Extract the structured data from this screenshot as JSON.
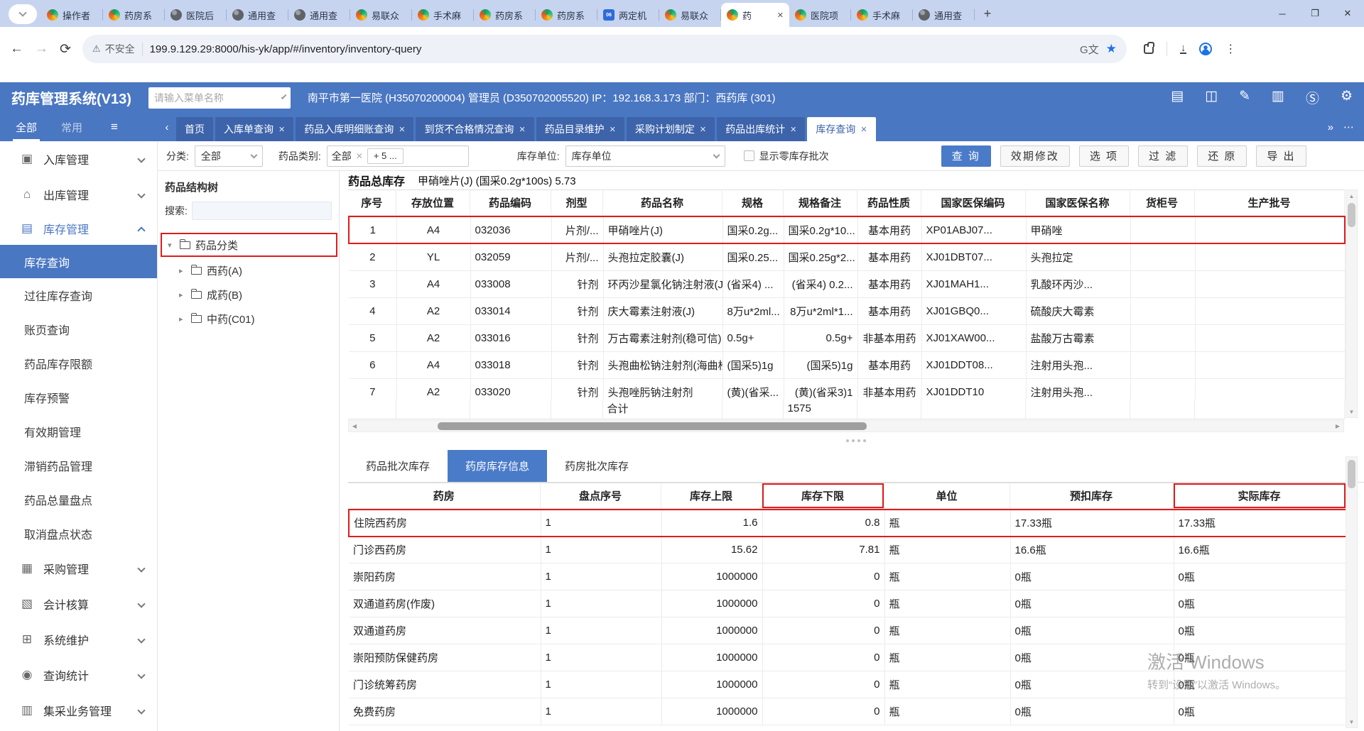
{
  "accent_color": "#4a77c2",
  "annotation_red": "#e11b1b",
  "browser": {
    "tabs": [
      {
        "label": "操作者",
        "icon": "swirl"
      },
      {
        "label": "药房系",
        "icon": "swirl"
      },
      {
        "label": "医院后",
        "icon": "globe"
      },
      {
        "label": "通用查",
        "icon": "globe"
      },
      {
        "label": "通用查",
        "icon": "globe"
      },
      {
        "label": "易联众",
        "icon": "swirl"
      },
      {
        "label": "手术麻",
        "icon": "swirl"
      },
      {
        "label": "药房系",
        "icon": "swirl"
      },
      {
        "label": "药房系",
        "icon": "swirl"
      },
      {
        "label": "两定机",
        "icon": "bluesq",
        "badge": "06"
      },
      {
        "label": "易联众",
        "icon": "swirl"
      },
      {
        "label": "药",
        "icon": "swirl",
        "active": true
      },
      {
        "label": "医院项",
        "icon": "swirl"
      },
      {
        "label": "手术麻",
        "icon": "swirl"
      },
      {
        "label": "通用查",
        "icon": "globe"
      }
    ],
    "close_tab_glyph": "✕",
    "new_tab_glyph": "+",
    "window_controls": {
      "minimize": "─",
      "maximize": "❐",
      "close": "✕"
    },
    "back_glyph": "←",
    "forward_glyph": "→",
    "refresh_glyph": "⟳",
    "security_warning_glyph": "⚠",
    "security_label": "不安全",
    "url": "199.9.129.29:8000/his-yk/app/#/inventory/inventory-query",
    "menu_dots": "⋮"
  },
  "app_header": {
    "title": "药库管理系统(V13)",
    "menu_search_placeholder": "请输入菜单名称",
    "user_info": "南平市第一医院 (H35070200004) 管理员 (D350702005520) IP：192.168.3.173 部门：西药库 (301)",
    "icons": [
      {
        "name": "card-icon",
        "glyph": "▤"
      },
      {
        "name": "screen-share-icon",
        "glyph": "◫"
      },
      {
        "name": "sign-icon",
        "glyph": "✎"
      },
      {
        "name": "receipt-icon",
        "glyph": "▥"
      },
      {
        "name": "currency-icon",
        "glyph": "Ⓢ"
      },
      {
        "name": "gear-icon",
        "glyph": "⚙"
      }
    ]
  },
  "nav": {
    "groups": [
      {
        "label": "全部",
        "active": true
      },
      {
        "label": "常用",
        "active": false
      }
    ],
    "collapse_glyph": "≡",
    "back_glyph": "‹",
    "tabs": [
      {
        "label": "首页",
        "closable": false
      },
      {
        "label": "入库单查询",
        "closable": true
      },
      {
        "label": "药品入库明细账查询",
        "closable": true
      },
      {
        "label": "到货不合格情况查询",
        "closable": true
      },
      {
        "label": "药品目录维护",
        "closable": true
      },
      {
        "label": "采购计划制定",
        "closable": true
      },
      {
        "label": "药品出库统计",
        "closable": true
      },
      {
        "label": "库存查询",
        "closable": true,
        "active": true
      }
    ],
    "overflow_glyph": "»",
    "more_glyph": "⋯"
  },
  "sidebar": {
    "items": [
      {
        "label": "入库管理",
        "type": "top",
        "icon": "inbox-icon",
        "glyph": "▣",
        "chevron": "down"
      },
      {
        "label": "出库管理",
        "type": "top",
        "icon": "outbox-icon",
        "glyph": "⌂",
        "chevron": "down"
      },
      {
        "label": "库存管理",
        "type": "top",
        "icon": "stock-folder-icon",
        "glyph": "▤",
        "chevron": "up",
        "active": true
      },
      {
        "label": "库存查询",
        "type": "sub",
        "active": true
      },
      {
        "label": "过往库存查询",
        "type": "sub"
      },
      {
        "label": "账页查询",
        "type": "sub"
      },
      {
        "label": "药品库存限额",
        "type": "sub"
      },
      {
        "label": "库存预警",
        "type": "sub"
      },
      {
        "label": "有效期管理",
        "type": "sub"
      },
      {
        "label": "滞销药品管理",
        "type": "sub"
      },
      {
        "label": "药品总量盘点",
        "type": "sub"
      },
      {
        "label": "取消盘点状态",
        "type": "sub"
      },
      {
        "label": "采购管理",
        "type": "top",
        "icon": "purchase-icon",
        "glyph": "▦",
        "chevron": "down"
      },
      {
        "label": "会计核算",
        "type": "top",
        "icon": "accounting-icon",
        "glyph": "▧",
        "chevron": "down"
      },
      {
        "label": "系统维护",
        "type": "top",
        "icon": "system-icon",
        "glyph": "⊞",
        "chevron": "down"
      },
      {
        "label": "查询统计",
        "type": "top",
        "icon": "query-stats-icon",
        "glyph": "◉",
        "chevron": "down"
      },
      {
        "label": "集采业务管理",
        "type": "top",
        "icon": "procurement-icon",
        "glyph": "▥",
        "chevron": "down"
      }
    ]
  },
  "filters": {
    "category_label": "分类:",
    "category_value": "全部",
    "drug_type_label": "药品类别:",
    "drug_type_value": "全部",
    "drug_type_more": "+ 5 ...",
    "unit_label": "库存单位:",
    "unit_value": "库存单位",
    "zero_stock_label": "显示零库存批次",
    "buttons": [
      {
        "label": "查 询",
        "primary": true
      },
      {
        "label": "效期修改",
        "primary": false
      },
      {
        "label": "选 项",
        "primary": false
      },
      {
        "label": "过 滤",
        "primary": false
      },
      {
        "label": "还 原",
        "primary": false
      },
      {
        "label": "导 出",
        "primary": false
      }
    ]
  },
  "tree": {
    "title": "药品结构树",
    "search_label": "搜索:",
    "search_value": "",
    "root": "药品分类",
    "children": [
      "西药(A)",
      "成药(B)",
      "中药(C01)"
    ]
  },
  "upper_table": {
    "summary_label": "药品总库存",
    "summary_value": "甲硝唑片(J)   (国采0.2g*100s) 5.73",
    "columns": [
      "序号",
      "存放位置",
      "药品编码",
      "剂型",
      "药品名称",
      "规格",
      "规格备注",
      "药品性质",
      "国家医保编码",
      "国家医保名称",
      "货柜号",
      "生产批号"
    ],
    "rows": [
      [
        "1",
        "A4",
        "032036",
        "片剂/...",
        "甲硝唑片(J)",
        "国采0.2g...",
        "国采0.2g*10...",
        "基本用药",
        "XP01ABJ07...",
        "甲硝唑",
        "",
        ""
      ],
      [
        "2",
        "YL",
        "032059",
        "片剂/...",
        "头孢拉定胶囊(J)",
        "国采0.25...",
        "国采0.25g*2...",
        "基本用药",
        "XJ01DBT07...",
        "头孢拉定",
        "",
        ""
      ],
      [
        "3",
        "A4",
        "033008",
        "针剂",
        "环丙沙星氯化钠注射液(J)",
        "(省采4) ...",
        "(省采4) 0.2...",
        "基本用药",
        "XJ01MAH1...",
        "乳酸环丙沙...",
        "",
        ""
      ],
      [
        "4",
        "A2",
        "033014",
        "针剂",
        "庆大霉素注射液(J)",
        "8万u*2ml...",
        "8万u*2ml*1...",
        "基本用药",
        "XJ01GBQ0...",
        "硫酸庆大霉素",
        "",
        ""
      ],
      [
        "5",
        "A2",
        "033016",
        "针剂",
        "万古霉素注射剂(稳可信)",
        "0.5g+",
        "0.5g+",
        "非基本用药",
        "XJ01XAW00...",
        "盐酸万古霉素",
        "",
        ""
      ],
      [
        "6",
        "A4",
        "033018",
        "针剂",
        "头孢曲松钠注射剂(海曲松)",
        "(国采5)1g",
        "(国采5)1g",
        "基本用药",
        "XJ01DDT08...",
        "注射用头孢...",
        "",
        ""
      ],
      [
        "7",
        "A2",
        "033020",
        "针剂",
        "头孢唑肟钠注射剂",
        "(黄)(省采...",
        "(黄)(省采3)1",
        "非基本用药",
        "XJ01DDT10",
        "注射用头孢...",
        "",
        ""
      ]
    ],
    "highlighted_row_index": 0,
    "total_label": "合计",
    "total_value": "1575"
  },
  "bottom_panel": {
    "tabs": [
      {
        "label": "药品批次库存",
        "active": false
      },
      {
        "label": "药房库存信息",
        "active": true
      },
      {
        "label": "药房批次库存",
        "active": false
      }
    ],
    "columns": [
      "药房",
      "盘点序号",
      "库存上限",
      "库存下限",
      "单位",
      "预扣库存",
      "实际库存"
    ],
    "red_boxed_columns": [
      3,
      6
    ],
    "rows": [
      [
        "住院西药房",
        "1",
        "1.6",
        "0.8",
        "瓶",
        "17.33瓶",
        "17.33瓶"
      ],
      [
        "门诊西药房",
        "1",
        "15.62",
        "7.81",
        "瓶",
        "16.6瓶",
        "16.6瓶"
      ],
      [
        "崇阳药房",
        "1",
        "1000000",
        "0",
        "瓶",
        "0瓶",
        "0瓶"
      ],
      [
        "双通道药房(作废)",
        "1",
        "1000000",
        "0",
        "瓶",
        "0瓶",
        "0瓶"
      ],
      [
        "双通道药房",
        "1",
        "1000000",
        "0",
        "瓶",
        "0瓶",
        "0瓶"
      ],
      [
        "崇阳预防保健药房",
        "1",
        "1000000",
        "0",
        "瓶",
        "0瓶",
        "0瓶"
      ],
      [
        "门诊统筹药房",
        "1",
        "1000000",
        "0",
        "瓶",
        "0瓶",
        "0瓶"
      ],
      [
        "免费药房",
        "1",
        "1000000",
        "0",
        "瓶",
        "0瓶",
        "0瓶"
      ]
    ],
    "highlighted_row_index": 0
  },
  "watermark": {
    "line1": "激活 Windows",
    "line2": "转到“设置”以激活 Windows。"
  }
}
